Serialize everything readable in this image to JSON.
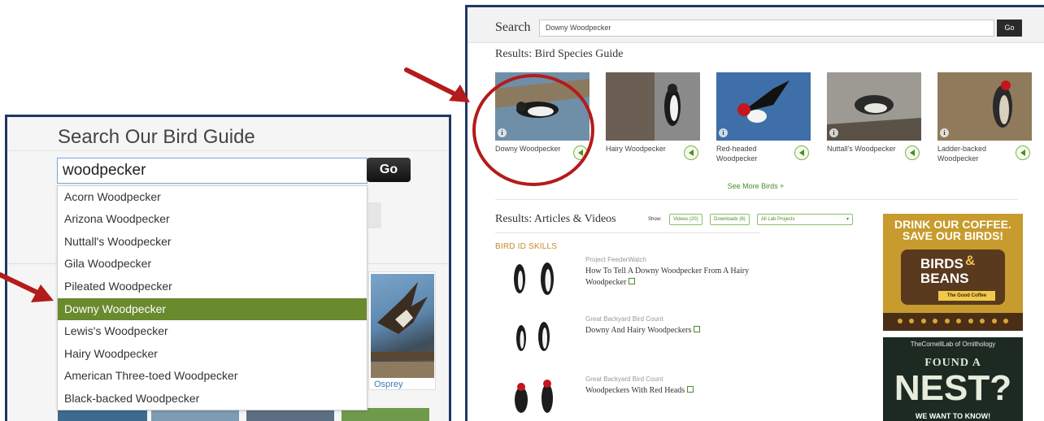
{
  "left": {
    "title": "Search Our Bird Guide",
    "search_value": "woodpecker",
    "go_label": "Go",
    "suggestions": [
      "Acorn Woodpecker",
      "Arizona Woodpecker",
      "Nuttall's Woodpecker",
      "Gila Woodpecker",
      "Pileated Woodpecker",
      "Downy Woodpecker",
      "Lewis's Woodpecker",
      "Hairy Woodpecker",
      "American Three-toed Woodpecker",
      "Black-backed Woodpecker"
    ],
    "selected_suggestion": "Downy Woodpecker",
    "osprey_label": "Osprey"
  },
  "right": {
    "search_label": "Search",
    "search_value": "Downy Woodpecker",
    "go_label": "Go",
    "species_heading": "Results: Bird Species Guide",
    "birds": [
      {
        "name": "Downy Woodpecker"
      },
      {
        "name": "Hairy Woodpecker"
      },
      {
        "name": "Red-headed Woodpecker"
      },
      {
        "name": "Nuttall's Woodpecker"
      },
      {
        "name": "Ladder-backed Woodpecker"
      }
    ],
    "see_more": "See More Birds +",
    "articles_heading": "Results: Articles & Videos",
    "show_label": "Show:",
    "filters": {
      "videos": "Videos (20)",
      "downloads": "Downloads (6)",
      "projects": "All Lab Projects"
    },
    "skill_heading": "BIRD ID SKILLS",
    "articles": [
      {
        "source": "Project FeederWatch",
        "title": "How To Tell A Downy Woodpecker From A Hairy Woodpecker"
      },
      {
        "source": "Great Backyard Bird Count",
        "title": "Downy And Hairy Woodpeckers"
      },
      {
        "source": "Great Backyard Bird Count",
        "title": "Woodpeckers With Red Heads"
      }
    ],
    "ad_coffee": {
      "line1": "DRINK OUR COFFEE.",
      "line2": "SAVE OUR BIRDS!",
      "brand_a": "BIRDS",
      "amp": "&",
      "brand_b": "BEANS",
      "tagline": "The Good Coffee"
    },
    "ad_nest": {
      "lab": "TheCornellLab of Ornithology",
      "found": "FOUND A",
      "nest": "NEST?",
      "want": "WE WANT TO KNOW!"
    }
  },
  "colors": {
    "panel_border": "#1f3864",
    "selected_green": "#6a8a2e",
    "arrow_red": "#b41b1b",
    "accent_green": "#4a8c2a"
  }
}
